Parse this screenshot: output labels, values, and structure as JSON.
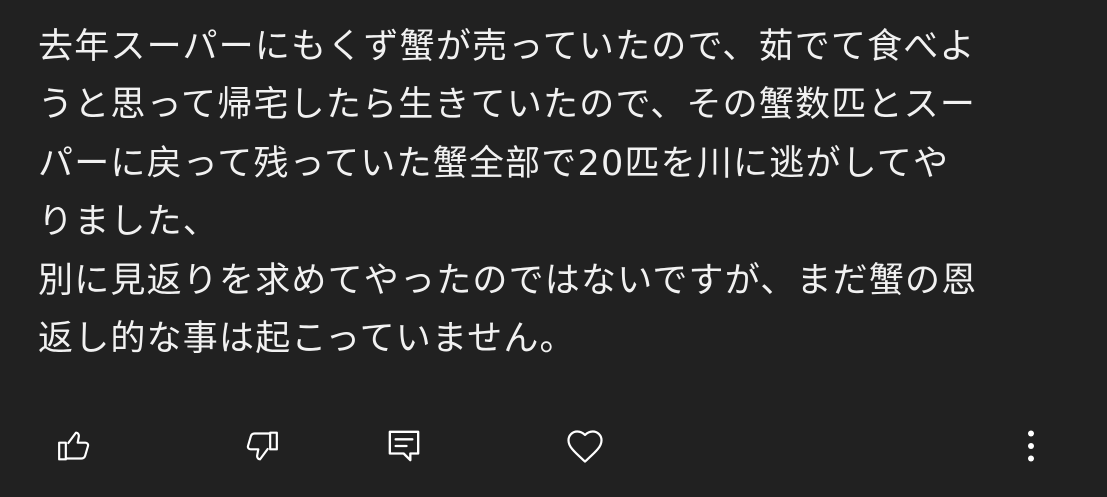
{
  "comment": {
    "lines": [
      "去年スーパーにもくず蟹が売っていたので、茹でて食べよ",
      "うと思って帰宅したら生きていたので、その蟹数匹とスー",
      "パーに戻って残っていた蟹全部で20匹を川に逃がしてや",
      "りました、",
      "別に見返りを求めてやったのではないですが、まだ蟹の恩",
      "返し的な事は起こっていません。"
    ]
  },
  "actions": {
    "like_icon": "thumbs-up-icon",
    "dislike_icon": "thumbs-down-icon",
    "reply_icon": "reply-comment-icon",
    "heart_icon": "heart-icon",
    "more_icon": "more-vertical-icon"
  },
  "colors": {
    "background": "#212121",
    "text": "#f1f1f1",
    "icon": "#ffffff"
  }
}
